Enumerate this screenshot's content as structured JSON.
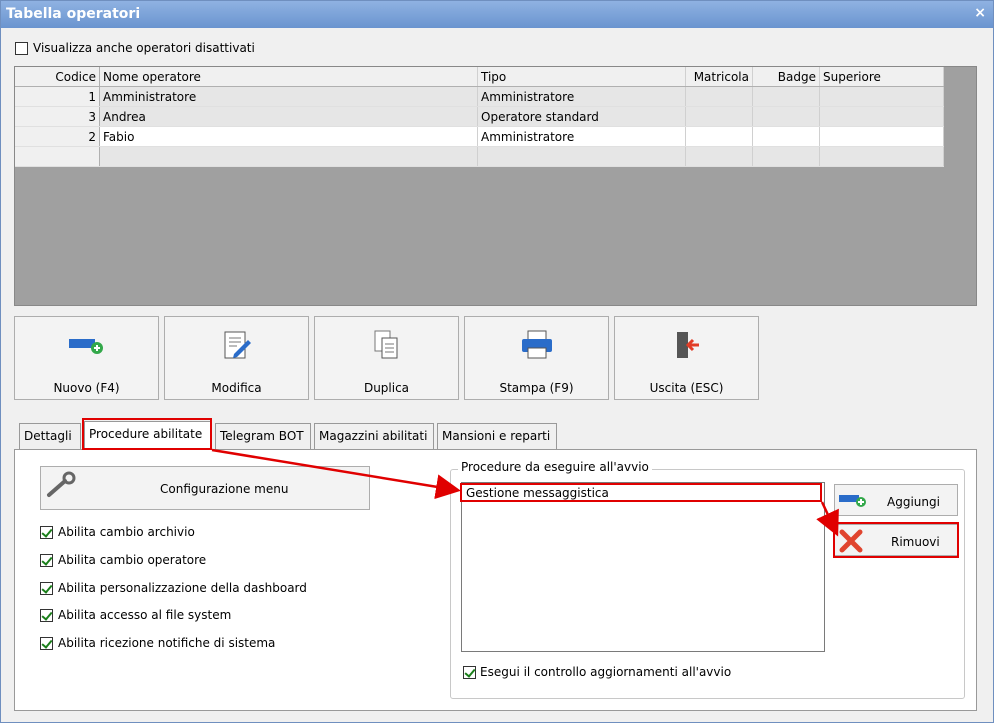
{
  "window": {
    "title": "Tabella operatori",
    "close": "×"
  },
  "filter": {
    "show_disabled_label": "Visualizza anche operatori disattivati",
    "checked": false
  },
  "grid": {
    "columns": [
      "Codice",
      "Nome operatore",
      "Tipo",
      "Matricola",
      "Badge",
      "Superiore"
    ],
    "rows": [
      {
        "codice": "1",
        "nome": "Amministratore",
        "tipo": "Amministratore",
        "matricola": "",
        "badge": "",
        "superiore": ""
      },
      {
        "codice": "3",
        "nome": "Andrea",
        "tipo": "Operatore standard",
        "matricola": "",
        "badge": "",
        "superiore": ""
      },
      {
        "codice": "2",
        "nome": "Fabio",
        "tipo": "Amministratore",
        "matricola": "",
        "badge": "",
        "superiore": ""
      }
    ]
  },
  "toolbar": {
    "new": "Nuovo (F4)",
    "edit": "Modifica",
    "duplicate": "Duplica",
    "print": "Stampa (F9)",
    "exit": "Uscita (ESC)"
  },
  "tabs": [
    "Dettagli",
    "Procedure abilitate",
    "Telegram BOT",
    "Magazzini abilitati",
    "Mansioni e reparti"
  ],
  "active_tab": "Procedure abilitate",
  "procedure": {
    "config_menu": "Configurazione menu",
    "options": [
      {
        "label": "Abilita cambio archivio",
        "checked": true
      },
      {
        "label": "Abilita cambio operatore",
        "checked": true
      },
      {
        "label": "Abilita personalizzazione della dashboard",
        "checked": true
      },
      {
        "label": "Abilita accesso al file system",
        "checked": true
      },
      {
        "label": "Abilita ricezione notifiche di sistema",
        "checked": true
      }
    ],
    "startup_group": "Procedure da eseguire all'avvio",
    "startup_items": [
      "Gestione messaggistica"
    ],
    "add": "Aggiungi",
    "remove": "Rimuovi",
    "check_updates": {
      "label": "Esegui il controllo aggiornamenti all'avvio",
      "checked": true
    }
  },
  "colors": {
    "titlebar": "#7ba2d8",
    "highlight": "#e00000",
    "check": "#1a7f1a"
  }
}
